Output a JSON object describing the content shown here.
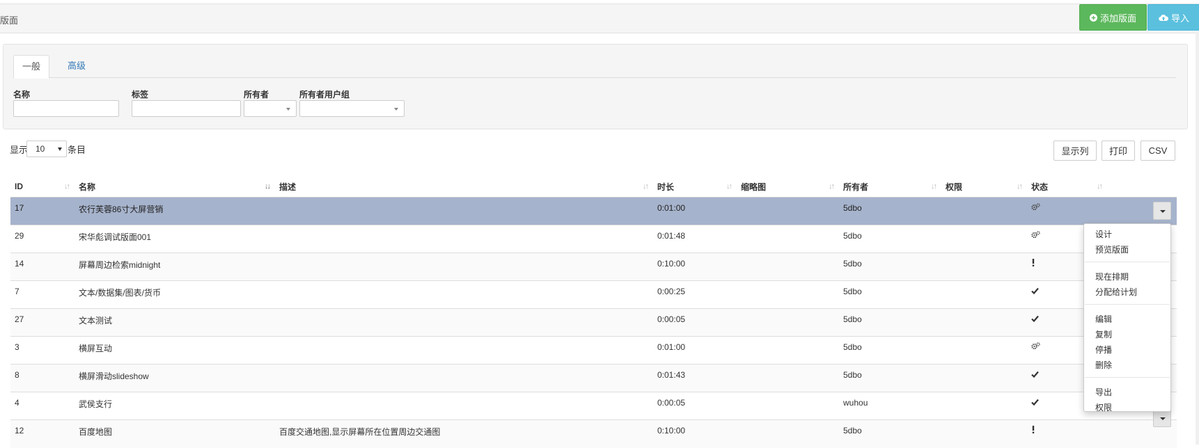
{
  "header": {
    "page_title": "版面",
    "add_button": "添加版面",
    "import_button": "导入"
  },
  "filter": {
    "tabs": [
      "一般",
      "高级"
    ],
    "labels": {
      "name": "名称",
      "tags": "标签",
      "owner": "所有者",
      "owner_group": "所有者用户组"
    }
  },
  "table_controls": {
    "show_label": "显示",
    "page_length": "10",
    "entries_label": "条目",
    "buttons": [
      "显示列",
      "打印",
      "CSV"
    ]
  },
  "columns": [
    "ID",
    "名称",
    "描述",
    "时长",
    "缩略图",
    "所有者",
    "权限",
    "状态"
  ],
  "rows": [
    {
      "id": "17",
      "name": "农行芙蓉86寸大屏营销",
      "desc": "",
      "duration": "0:01:00",
      "owner": "5dbo",
      "status": "gears-icon"
    },
    {
      "id": "29",
      "name": "宋华彪调试版面001",
      "desc": "",
      "duration": "0:01:48",
      "owner": "5dbo",
      "status": "gears-icon"
    },
    {
      "id": "14",
      "name": "屏幕周边检索midnight",
      "desc": "",
      "duration": "0:10:00",
      "owner": "5dbo",
      "status": "exclamation-icon"
    },
    {
      "id": "7",
      "name": "文本/数据集/图表/货币",
      "desc": "",
      "duration": "0:00:25",
      "owner": "5dbo",
      "status": "check-icon"
    },
    {
      "id": "27",
      "name": "文本测试",
      "desc": "",
      "duration": "0:00:05",
      "owner": "5dbo",
      "status": "check-icon"
    },
    {
      "id": "3",
      "name": "横屏互动",
      "desc": "",
      "duration": "0:01:00",
      "owner": "5dbo",
      "status": "gears-icon"
    },
    {
      "id": "8",
      "name": "横屏滑动slideshow",
      "desc": "",
      "duration": "0:01:43",
      "owner": "5dbo",
      "status": "check-icon"
    },
    {
      "id": "4",
      "name": "武侯支行",
      "desc": "",
      "duration": "0:00:05",
      "owner": "wuhou",
      "status": "check-icon"
    },
    {
      "id": "12",
      "name": "百度地图",
      "desc": "百度交通地图,显示屏幕所在位置周边交通图",
      "duration": "0:10:00",
      "owner": "5dbo",
      "status": "exclamation-icon"
    }
  ],
  "row_menu": {
    "groups": [
      [
        "设计",
        "预览版面"
      ],
      [
        "现在排期",
        "分配给计划"
      ],
      [
        "编辑",
        "复制",
        "停播",
        "删除"
      ],
      [
        "导出",
        "权限"
      ]
    ]
  },
  "colors": {
    "success": "#5cb85c",
    "info": "#5bc0de",
    "selected_row": "#a6b3cc",
    "link": "#337ab7"
  }
}
